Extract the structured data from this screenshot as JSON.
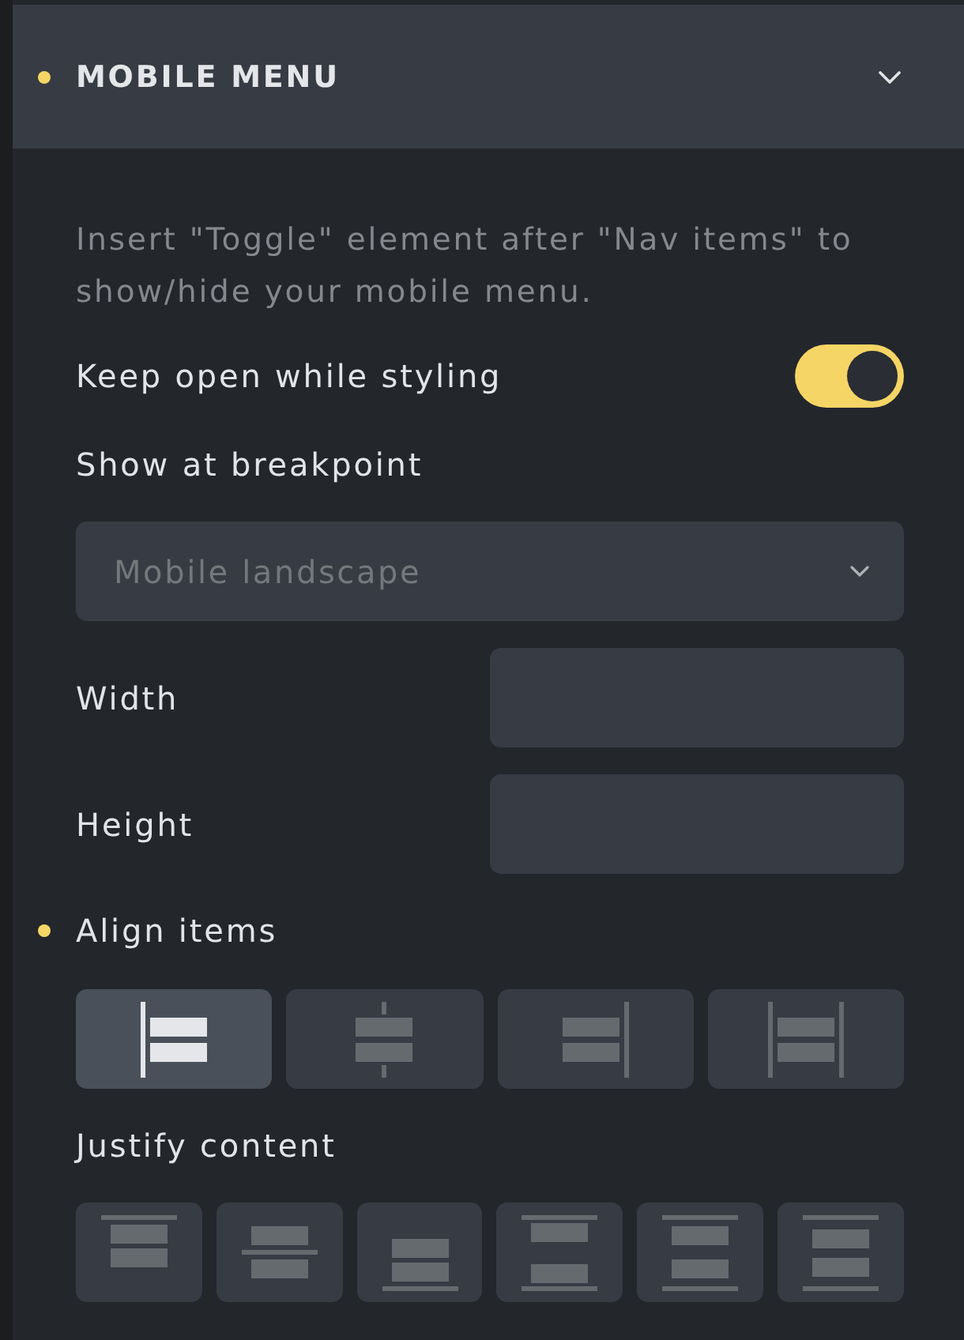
{
  "section": {
    "title": "MOBILE MENU",
    "has_value": true,
    "expanded": true
  },
  "description": "Insert \"Toggle\" element after \"Nav items\" to show/hide your mobile menu.",
  "keep_open": {
    "label": "Keep open while styling",
    "on": true
  },
  "breakpoint": {
    "label": "Show at breakpoint",
    "placeholder": "Mobile landscape"
  },
  "width": {
    "label": "Width"
  },
  "height": {
    "label": "Height"
  },
  "align_items": {
    "label": "Align items",
    "has_value": true,
    "options": [
      {
        "kind": "start",
        "selected": true
      },
      {
        "kind": "center",
        "selected": false
      },
      {
        "kind": "end",
        "selected": false
      },
      {
        "kind": "stretch",
        "selected": false
      }
    ]
  },
  "justify_content": {
    "label": "Justify content",
    "has_value": false,
    "options": [
      {
        "kind": "start",
        "selected": false
      },
      {
        "kind": "center",
        "selected": false
      },
      {
        "kind": "end",
        "selected": false
      },
      {
        "kind": "space-between",
        "selected": false
      },
      {
        "kind": "space-around",
        "selected": false
      },
      {
        "kind": "space-evenly",
        "selected": false
      }
    ]
  }
}
